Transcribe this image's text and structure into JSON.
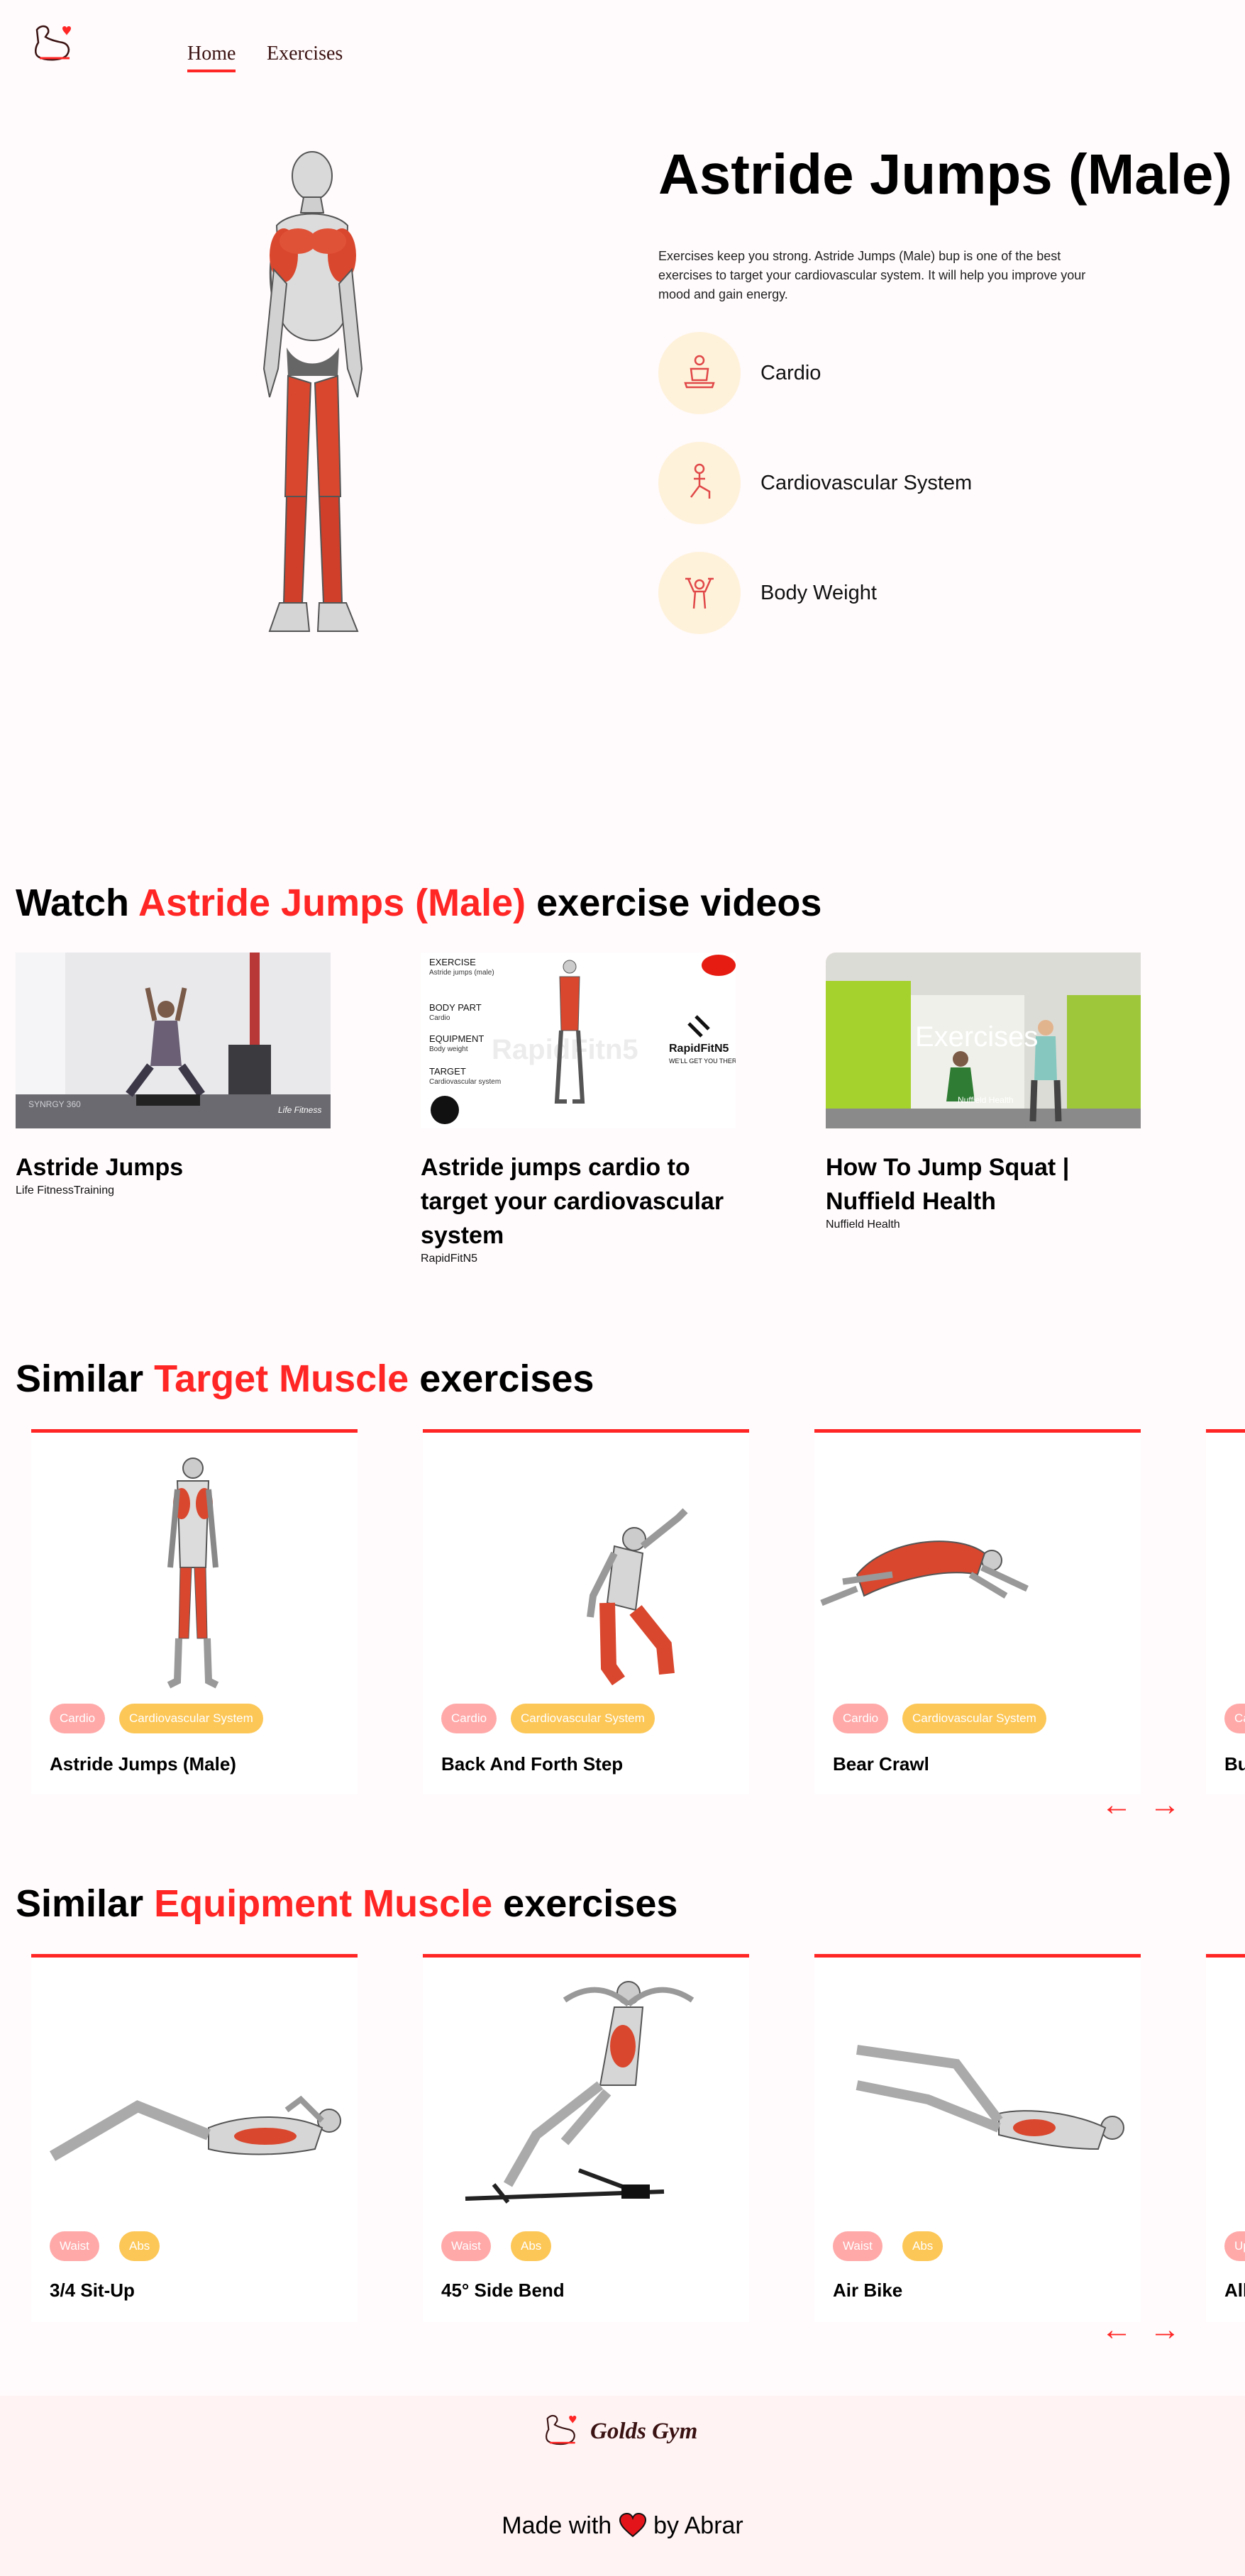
{
  "nav": {
    "logo": "gym-logo-icon",
    "home_label": "Home",
    "exercises_label": "Exercises"
  },
  "hero": {
    "title": "Astride Jumps (Male)",
    "description": "Exercises keep you strong. Astride Jumps (Male) bup is one of the best exercises to target your cardiovascular system. It will help you improve your mood and gain energy.",
    "details": [
      {
        "icon": "meditation-icon",
        "label": "Cardio"
      },
      {
        "icon": "lunge-icon",
        "label": "Cardiovascular System"
      },
      {
        "icon": "dumbbell-lift-icon",
        "label": "Body Weight"
      }
    ]
  },
  "videos": {
    "heading_prefix": "Watch ",
    "heading_highlight": "Astride Jumps (Male)",
    "heading_suffix": " exercise videos",
    "items": [
      {
        "title": "Astride Jumps",
        "channel": "Life FitnessTraining",
        "thumb_caption_a": "SYNRGY 360",
        "thumb_caption_b": "Life Fitness"
      },
      {
        "title": "Astride jumps cardio to target your cardiovascular system",
        "channel": "RapidFitN5",
        "thumb": {
          "l1": "EXERCISE",
          "l1s": "Astride jumps (male)",
          "l2": "BODY PART",
          "l2s": "Cardio",
          "l3": "EQUIPMENT",
          "l3s": "Body weight",
          "l4": "TARGET",
          "l4s": "Cardiovascular system",
          "watermark": "RapidFitn5",
          "brand": "RapidFitN5",
          "tagline": "WE'LL GET YOU THERE!"
        }
      },
      {
        "title": "How To Jump Squat | Nuffield Health",
        "channel": "Nuffield Health",
        "thumb_caption": "Exercises",
        "thumb_brand": "Nuffield Health"
      }
    ]
  },
  "similar_target": {
    "heading_prefix": "Similar ",
    "heading_highlight": "Target Muscle",
    "heading_suffix": " exercises",
    "cards": [
      {
        "name": "Astride Jumps (Male)",
        "tag1": "Cardio",
        "tag2": "Cardiovascular System"
      },
      {
        "name": "Back And Forth Step",
        "tag1": "Cardio",
        "tag2": "Cardiovascular System"
      },
      {
        "name": "Bear Crawl",
        "tag1": "Cardio",
        "tag2": "Cardiovascular System"
      },
      {
        "name": "Bu",
        "tag1": "Ca",
        "tag2": ""
      }
    ]
  },
  "similar_equipment": {
    "heading_prefix": "Similar ",
    "heading_highlight": "Equipment Muscle",
    "heading_suffix": " exercises",
    "cards": [
      {
        "name": "3/4 Sit-Up",
        "tag1": "Waist",
        "tag2": "Abs"
      },
      {
        "name": "45° Side Bend",
        "tag1": "Waist",
        "tag2": "Abs"
      },
      {
        "name": "Air Bike",
        "tag1": "Waist",
        "tag2": "Abs"
      },
      {
        "name": "All",
        "tag1": "Up",
        "tag2": ""
      }
    ]
  },
  "arrows": {
    "left": "←",
    "right": "→"
  },
  "footer": {
    "brand": "Golds Gym",
    "made_prefix": "Made with",
    "made_suffix": "by Abrar"
  },
  "colors": {
    "accent": "#ff2625",
    "pink_tag": "#ffa9a9",
    "yellow_tag": "#fcc757",
    "chip_bg": "#fff2db",
    "page_bg": "#fffafb"
  }
}
